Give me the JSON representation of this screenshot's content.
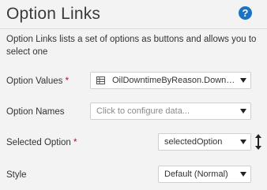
{
  "panel": {
    "title": "Option Links",
    "help_icon_glyph": "?",
    "description": "Option Links lists a set of options as buttons and allows you to select one"
  },
  "fields": {
    "option_values": {
      "label": "Option Values",
      "required_mark": "*",
      "value": "OilDowntimeByReason.Downtime",
      "icon": "table-icon"
    },
    "option_names": {
      "label": "Option Names",
      "placeholder": "Click to configure data..."
    },
    "selected_option": {
      "label": "Selected Option",
      "required_mark": "*",
      "value": "selectedOption",
      "binding_icon": "vertical-arrows-icon"
    },
    "style": {
      "label": "Style",
      "value": "Default (Normal)"
    }
  },
  "colors": {
    "help_icon": "#1b73c4",
    "required": "#d0021b",
    "background": "#f3f3f3"
  }
}
